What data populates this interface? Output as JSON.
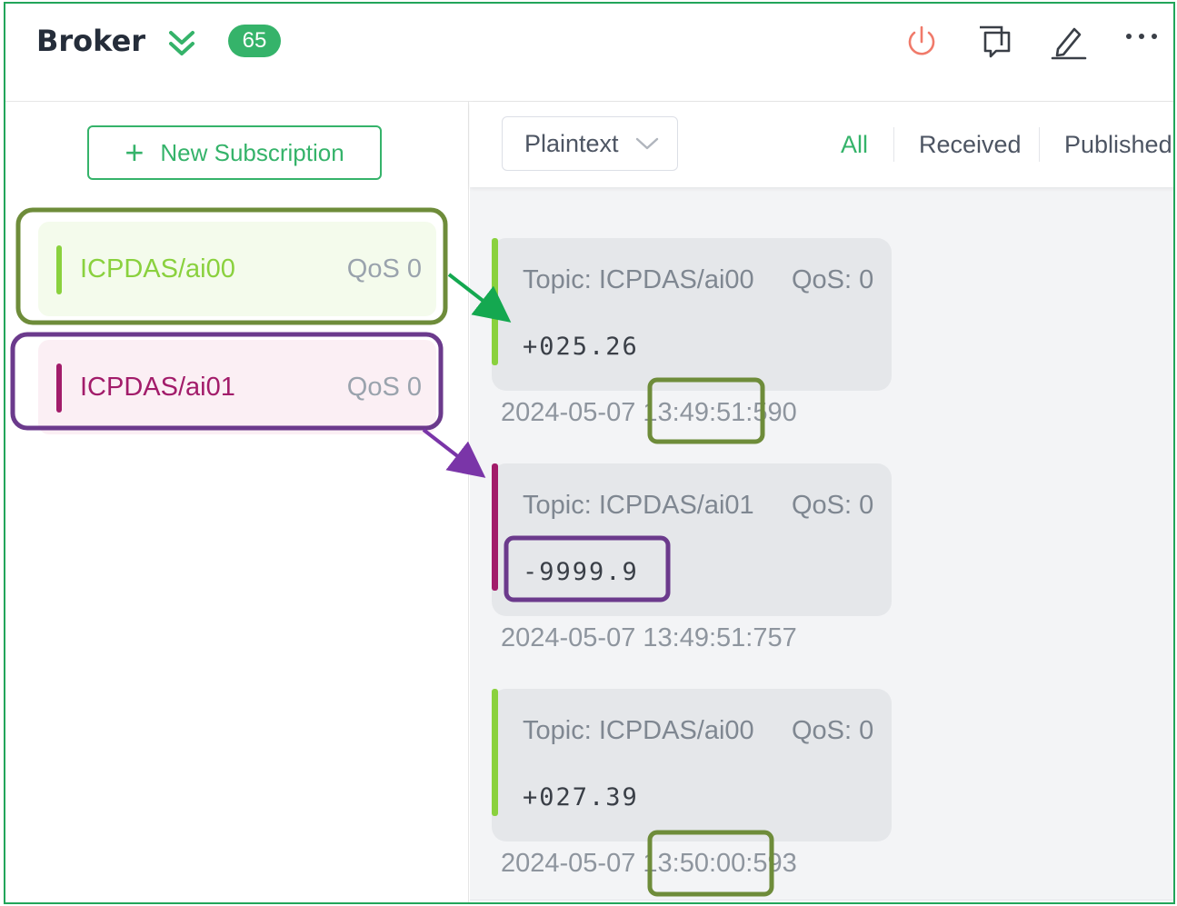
{
  "header": {
    "title": "Broker",
    "badge": "65",
    "icons": [
      "chevron-double-down-icon",
      "power-icon",
      "chat-icon",
      "edit-icon",
      "more-icon"
    ]
  },
  "left": {
    "new_subscription": "New Subscription",
    "subscriptions": [
      {
        "topic": "ICPDAS/ai00",
        "qos": "QoS 0",
        "color": "#8ad13e"
      },
      {
        "topic": "ICPDAS/ai01",
        "qos": "QoS 0",
        "color": "#a21c6a"
      }
    ]
  },
  "right": {
    "format": "Plaintext",
    "tabs": [
      "All",
      "Received",
      "Published"
    ],
    "active_tab": "All",
    "messages": [
      {
        "topic": "Topic: ICPDAS/ai00",
        "qos": "QoS: 0",
        "payload": "+025.26",
        "time": "2024-05-07 13:49:51:590",
        "color": "#8ad13e"
      },
      {
        "topic": "Topic: ICPDAS/ai01",
        "qos": "QoS: 0",
        "payload": "-9999.9",
        "time": "2024-05-07 13:49:51:757",
        "color": "#a21c6a"
      },
      {
        "topic": "Topic: ICPDAS/ai00",
        "qos": "QoS: 0",
        "payload": "+027.39",
        "time": "2024-05-07 13:50:00:593",
        "color": "#8ad13e"
      }
    ]
  },
  "colors": {
    "accent": "#35b36a",
    "annotation_green": "#6e8c3a",
    "annotation_purple": "#6b3a8c",
    "arrow_green": "#14a850",
    "arrow_purple": "#7a35a8"
  }
}
